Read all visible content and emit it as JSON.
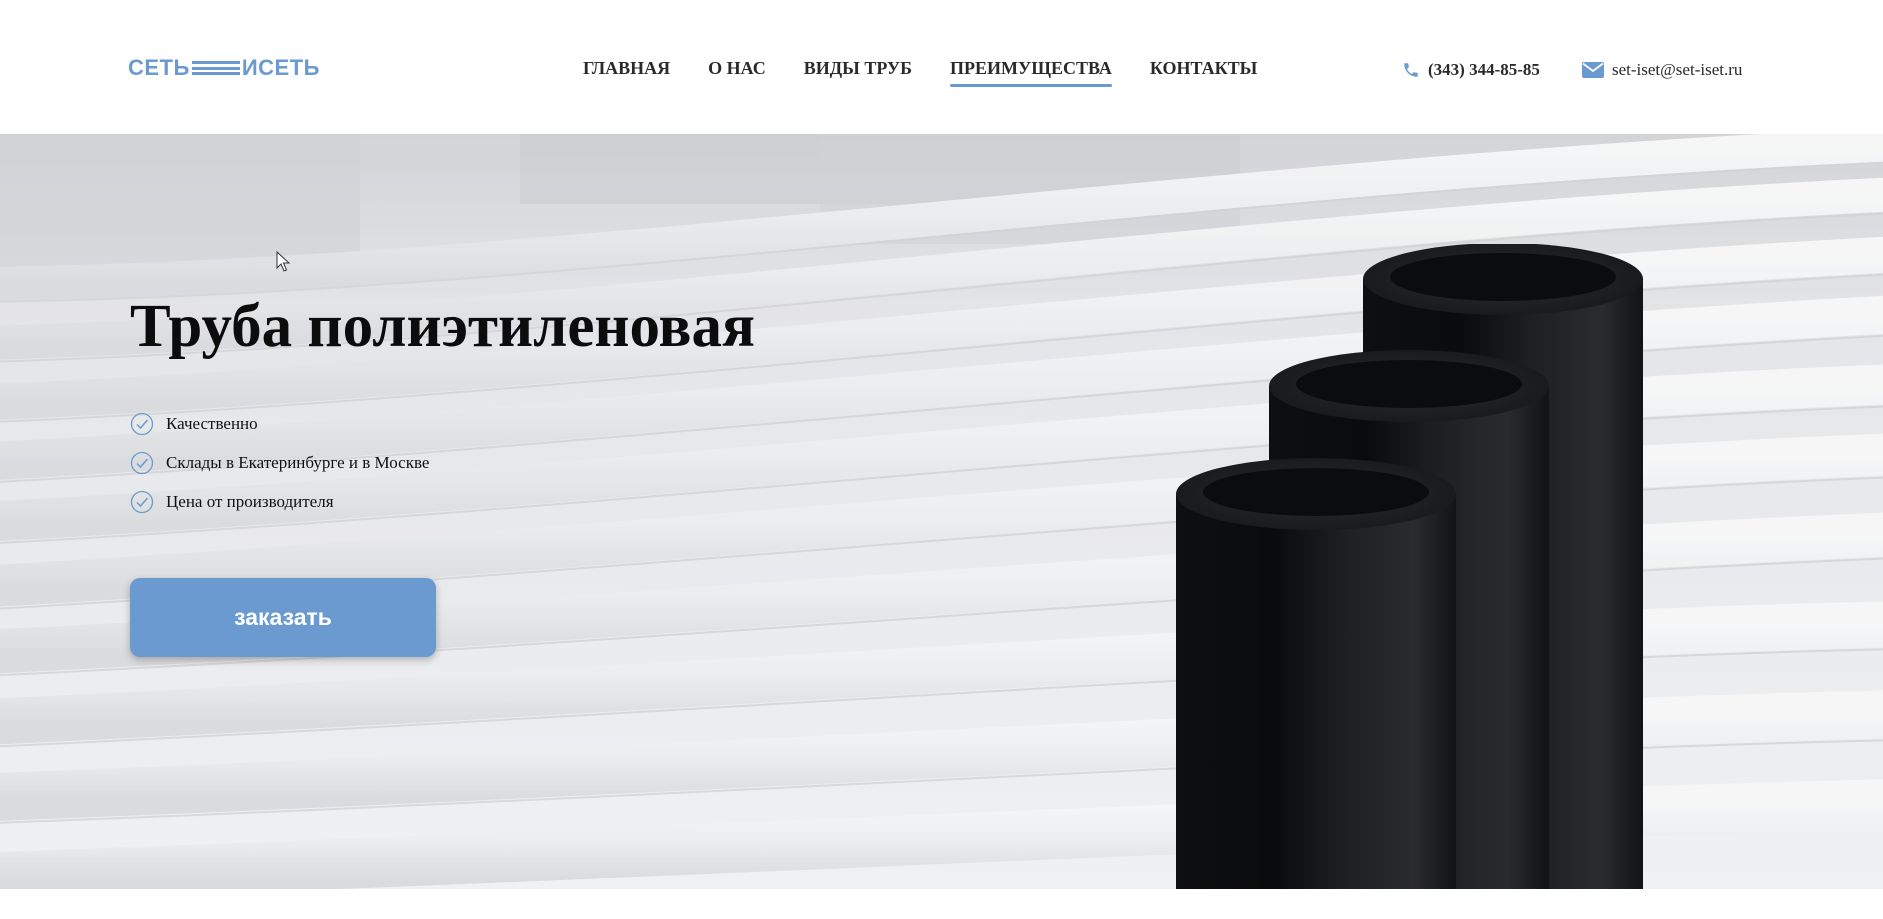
{
  "header": {
    "logo": {
      "left": "СЕТЬ",
      "right": "ИСЕТЬ"
    },
    "nav": [
      {
        "label": "ГЛАВНАЯ",
        "active": false
      },
      {
        "label": "О НАС",
        "active": false
      },
      {
        "label": "ВИДЫ ТРУБ",
        "active": false
      },
      {
        "label": "ПРЕИМУЩЕСТВА",
        "active": true
      },
      {
        "label": "КОНТАКТЫ",
        "active": false
      }
    ],
    "phone": {
      "icon": "phone-icon",
      "text": "(343) 344-85-85"
    },
    "email": {
      "icon": "mail-icon",
      "text": "set-iset@set-iset.ru"
    }
  },
  "hero": {
    "title": "Труба полиэтиленовая",
    "features": [
      {
        "icon": "check-circle-icon",
        "text": "Качественно"
      },
      {
        "icon": "check-circle-icon",
        "text": "Склады в Екатеринбурге и в Москве"
      },
      {
        "icon": "check-circle-icon",
        "text": "Цена от производителя"
      }
    ],
    "order_button": "заказать"
  },
  "colors": {
    "accent": "#6a9ad0",
    "text": "#1f1f1f",
    "pipe": "#141516"
  }
}
